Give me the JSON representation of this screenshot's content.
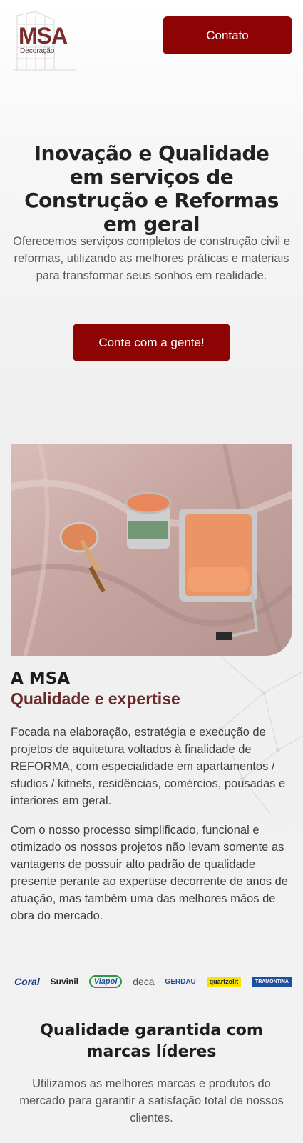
{
  "header": {
    "logo_text": "MSA",
    "logo_sub": "Decoração",
    "contact_label": "Contato"
  },
  "hero": {
    "title": "Inovação e Qualidade em serviços de Construção e Reformas em geral",
    "text": "Oferecemos serviços completos de construção civil e reformas, utilizando as melhores práticas e materiais para transformar seus sonhos em realidade.",
    "cta_label": "Conte com a gente!"
  },
  "about": {
    "title": "A MSA",
    "subtitle": "Qualidade e expertise",
    "p1": "Focada na elaboração, estratégia e execução de projetos de aquitetura voltados à finalidade de REFORMA, com especialidade em apartamentos / studios / kitnets, residências, comércios, pousadas e interiores em geral.",
    "p2": "Com o nosso processo simplificado, funcional e otimizado os nossos projetos não levam somente as vantagens de possuir alto padrão de qualidade presente perante ao expertise decorrente de anos de atuação, mas também uma das melhores mãos de obra do mercado."
  },
  "brands": [
    "Coral",
    "Suvinil",
    "Viapol",
    "deca",
    "GERDAU",
    "quartzolit",
    "TRAMONTINA"
  ],
  "quality": {
    "title": "Qualidade garantida com marcas líderes",
    "text": "Utilizamos as melhores marcas e produtos do mercado para garantir a satisfação total de nossos clientes."
  },
  "colors": {
    "brand_red": "#8e0404",
    "accent_brown": "#6b2a2a"
  }
}
